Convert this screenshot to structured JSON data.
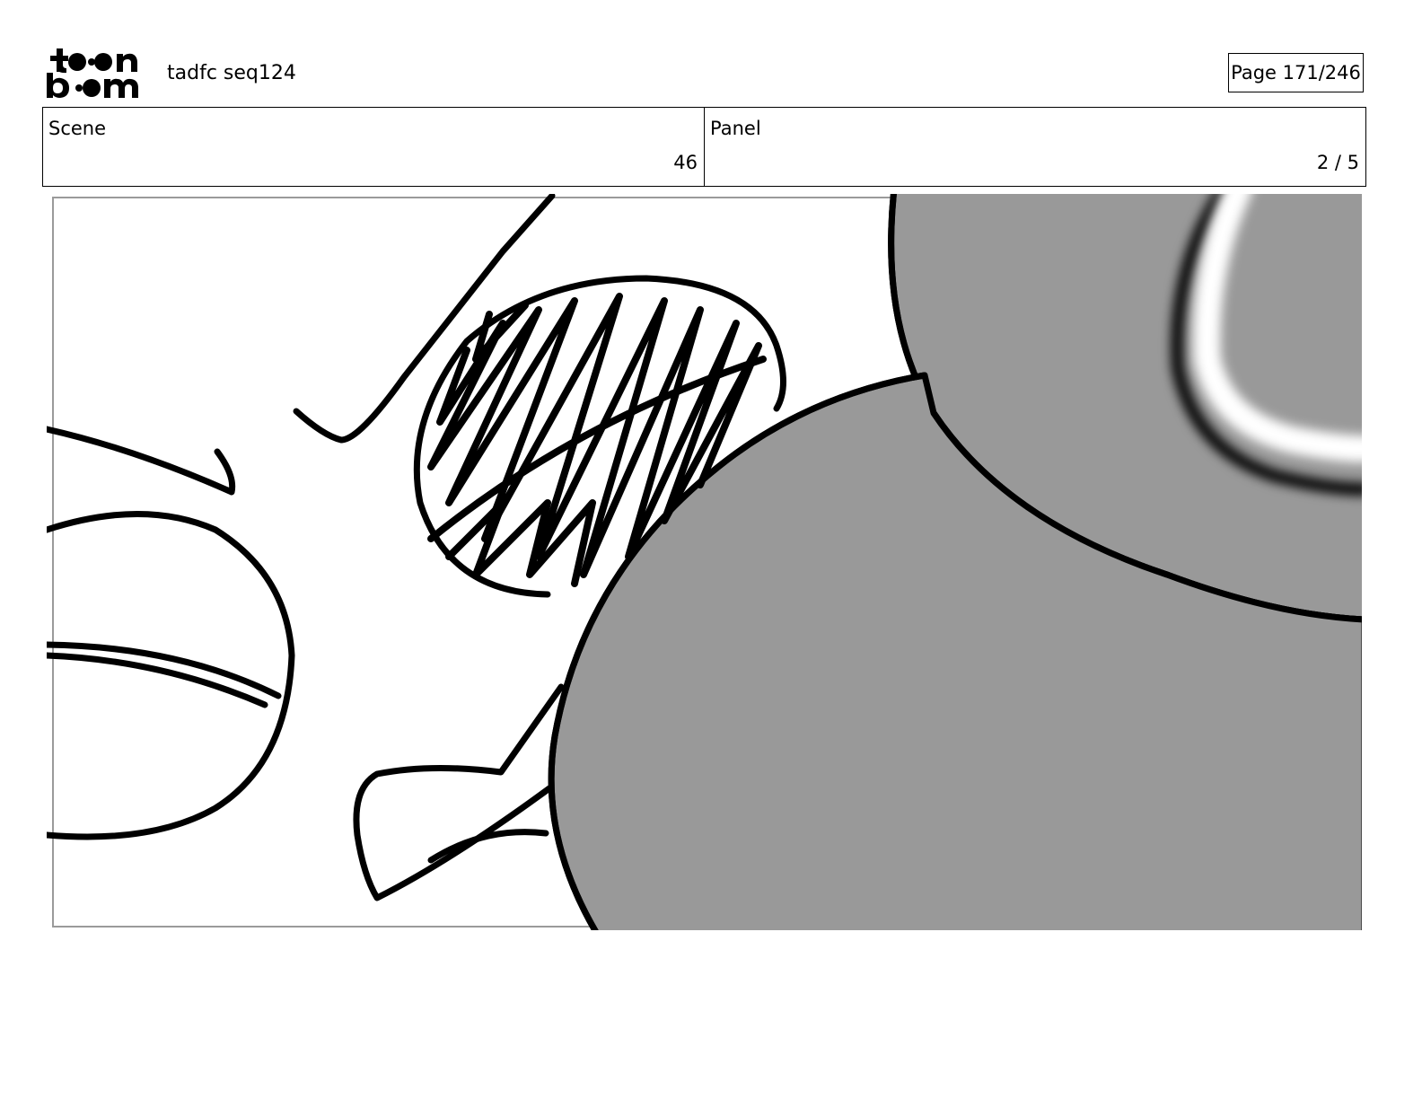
{
  "header": {
    "logo_text": "toonboom",
    "project_title": "tadfc seq124",
    "page_label": "Page 171/246"
  },
  "info": {
    "scene_label": "Scene",
    "scene_value": "46",
    "panel_label": "Panel",
    "panel_value": "2 / 5"
  },
  "panel": {
    "description": "sketch of cartoon characters",
    "fill_color": "#999999",
    "line_color": "#000000"
  }
}
